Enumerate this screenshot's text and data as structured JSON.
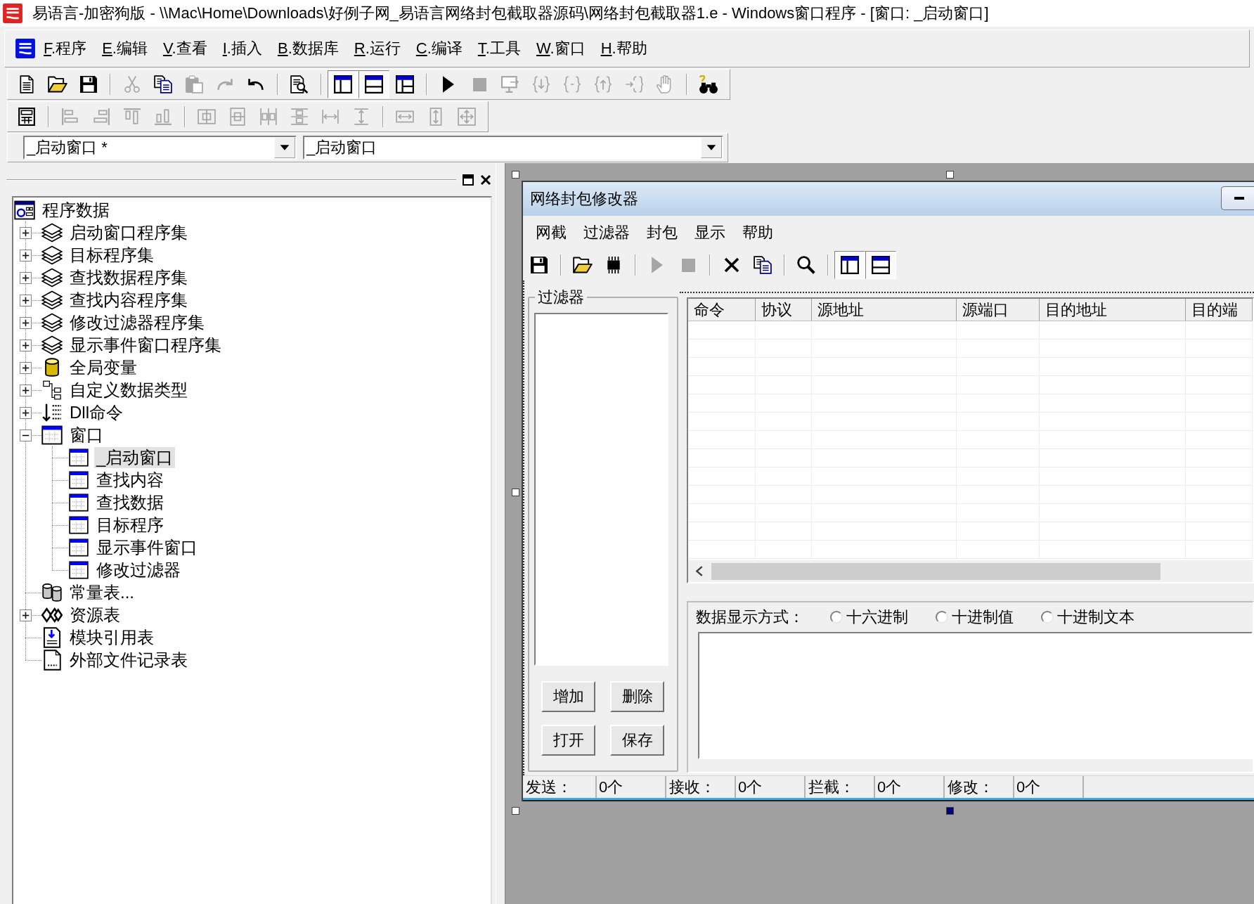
{
  "window": {
    "title": "易语言-加密狗版 - \\\\Mac\\Home\\Downloads\\好例子网_易语言网络封包截取器源码\\网络封包截取器1.e - Windows窗口程序 - [窗口: _启动窗口]"
  },
  "menu": [
    {
      "accel": "F",
      "label": ".程序"
    },
    {
      "accel": "E",
      "label": ".编辑"
    },
    {
      "accel": "V",
      "label": ".查看"
    },
    {
      "accel": "I",
      "label": ".插入"
    },
    {
      "accel": "B",
      "label": ".数据库"
    },
    {
      "accel": "R",
      "label": ".运行"
    },
    {
      "accel": "C",
      "label": ".编译"
    },
    {
      "accel": "T",
      "label": ".工具"
    },
    {
      "accel": "W",
      "label": ".窗口"
    },
    {
      "accel": "H",
      "label": ".帮助"
    }
  ],
  "toolbar_1": {
    "groups": [
      [
        {
          "disabled": false,
          "pressed": false
        },
        {
          "disabled": false,
          "pressed": false
        },
        {
          "disabled": false,
          "pressed": false
        }
      ],
      [
        {
          "disabled": true,
          "pressed": false
        },
        {
          "disabled": false,
          "pressed": false
        },
        {
          "disabled": true,
          "pressed": false
        },
        {
          "disabled": true,
          "pressed": false
        },
        {
          "disabled": false,
          "pressed": false
        }
      ],
      [
        {
          "disabled": false,
          "pressed": false
        }
      ],
      [
        {
          "disabled": false,
          "pressed": true
        },
        {
          "disabled": false,
          "pressed": true
        },
        {
          "disabled": false,
          "pressed": false
        }
      ],
      [
        {
          "disabled": false,
          "pressed": false
        },
        {
          "disabled": true,
          "pressed": false
        },
        {
          "disabled": true,
          "pressed": false
        },
        {
          "disabled": true,
          "pressed": false
        },
        {
          "disabled": true,
          "pressed": false
        },
        {
          "disabled": true,
          "pressed": false
        },
        {
          "disabled": true,
          "pressed": false
        },
        {
          "disabled": true,
          "pressed": false
        }
      ],
      [
        {
          "disabled": false,
          "pressed": false
        }
      ]
    ]
  },
  "toolbar_2": {
    "groups": [
      [
        {
          "disabled": false,
          "pressed": false
        }
      ],
      [
        {
          "disabled": true,
          "pressed": false
        },
        {
          "disabled": true,
          "pressed": false
        },
        {
          "disabled": true,
          "pressed": false
        },
        {
          "disabled": true,
          "pressed": false
        }
      ],
      [
        {
          "disabled": true,
          "pressed": false
        },
        {
          "disabled": true,
          "pressed": false
        },
        {
          "disabled": true,
          "pressed": false
        },
        {
          "disabled": true,
          "pressed": false
        },
        {
          "disabled": true,
          "pressed": false
        },
        {
          "disabled": true,
          "pressed": false
        }
      ],
      [
        {
          "disabled": true,
          "pressed": false
        },
        {
          "disabled": true,
          "pressed": false
        },
        {
          "disabled": true,
          "pressed": false
        }
      ]
    ]
  },
  "combos": [
    {
      "value": "_启动窗口 *"
    },
    {
      "value": "_启动窗口"
    }
  ],
  "project_tree": {
    "label": "程序数据",
    "kind": "project",
    "selected": false,
    "children": [
      {
        "label": "启动窗口程序集",
        "kind": "program_set",
        "expanded": false,
        "selected": false
      },
      {
        "label": "目标程序集",
        "kind": "program_set",
        "expanded": false,
        "selected": false
      },
      {
        "label": "查找数据程序集",
        "kind": "program_set",
        "expanded": false,
        "selected": false
      },
      {
        "label": "查找内容程序集",
        "kind": "program_set",
        "expanded": false,
        "selected": false
      },
      {
        "label": "修改过滤器程序集",
        "kind": "program_set",
        "expanded": false,
        "selected": false
      },
      {
        "label": "显示事件窗口程序集",
        "kind": "program_set",
        "expanded": false,
        "selected": false
      },
      {
        "label": "全局变量",
        "kind": "global_vars",
        "expanded": false,
        "selected": false
      },
      {
        "label": "自定义数据类型",
        "kind": "data_types",
        "expanded": false,
        "selected": false
      },
      {
        "label": "Dll命令",
        "kind": "dll_commands",
        "expanded": false,
        "selected": false
      },
      {
        "label": "窗口",
        "kind": "windows",
        "expanded": true,
        "selected": false,
        "children": [
          {
            "label": "_启动窗口",
            "kind": "window",
            "selected": true
          },
          {
            "label": "查找内容",
            "kind": "window",
            "selected": false
          },
          {
            "label": "查找数据",
            "kind": "window",
            "selected": false
          },
          {
            "label": "目标程序",
            "kind": "window",
            "selected": false
          },
          {
            "label": "显示事件窗口",
            "kind": "window",
            "selected": false
          },
          {
            "label": "修改过滤器",
            "kind": "window",
            "selected": false
          }
        ]
      },
      {
        "label": "常量表...",
        "kind": "constants",
        "selected": false
      },
      {
        "label": "资源表",
        "kind": "resources",
        "expanded": false,
        "selected": false
      },
      {
        "label": "模块引用表",
        "kind": "module_refs",
        "selected": false
      },
      {
        "label": "外部文件记录表",
        "kind": "external_files",
        "selected": false
      }
    ]
  },
  "designer": {
    "form": {
      "title": "网络封包修改器",
      "menu": [
        "网截",
        "过滤器",
        "封包",
        "显示",
        "帮助"
      ],
      "toolbar": {
        "groups": [
          [
            {
              "disabled": false,
              "pressed": false
            }
          ],
          [
            {
              "disabled": false,
              "pressed": false
            },
            {
              "disabled": false,
              "pressed": false
            }
          ],
          [
            {
              "disabled": true,
              "pressed": false
            },
            {
              "disabled": true,
              "pressed": false
            }
          ],
          [
            {
              "disabled": false,
              "pressed": false
            },
            {
              "disabled": false,
              "pressed": false
            }
          ],
          [
            {
              "disabled": false,
              "pressed": false
            }
          ],
          [
            {
              "disabled": false,
              "pressed": true
            },
            {
              "disabled": false,
              "pressed": true
            }
          ]
        ]
      },
      "filter_group": {
        "title": "过滤器",
        "buttons": [
          "增加",
          "删除",
          "打开",
          "保存"
        ]
      },
      "table": {
        "columns": [
          "命令",
          "协议",
          "源地址",
          "源端口",
          "目的地址",
          "目的端"
        ]
      },
      "display": {
        "label": "数据显示方式：",
        "options": [
          {
            "label": "十六进制",
            "selected": false
          },
          {
            "label": "十进制值",
            "selected": false
          },
          {
            "label": "十进制文本",
            "selected": false
          }
        ]
      },
      "status_bar": [
        {
          "label": "发送：",
          "value": "0个"
        },
        {
          "label": "接收：",
          "value": "0个"
        },
        {
          "label": "拦截：",
          "value": "0个"
        },
        {
          "label": "修改：",
          "value": "0个"
        }
      ]
    }
  }
}
